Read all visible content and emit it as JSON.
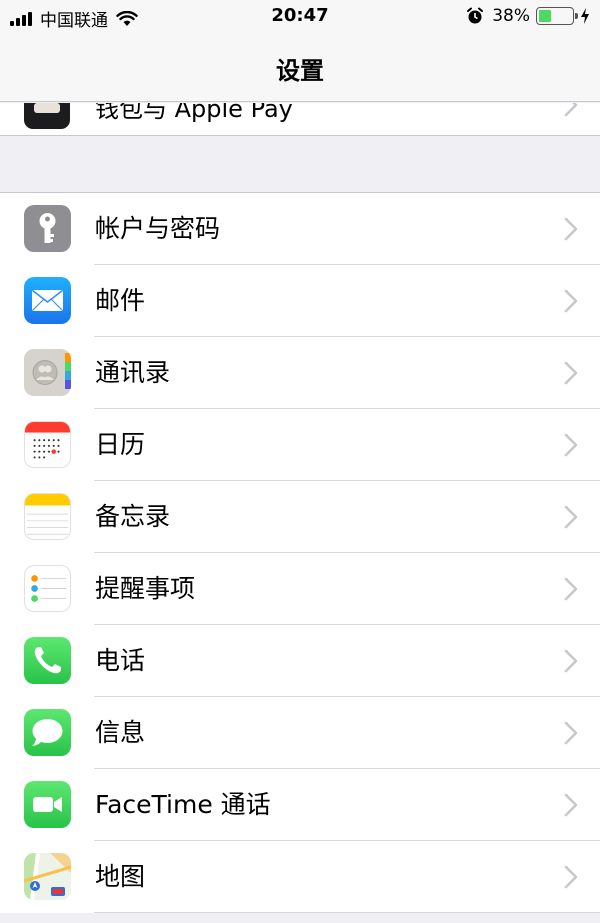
{
  "status_bar": {
    "carrier": "中国联通",
    "time": "20:47",
    "battery_percent": "38%",
    "battery_level": 0.38
  },
  "nav": {
    "title": "设置"
  },
  "partial_item": {
    "label": "钱包与 Apple Pay",
    "icon": "wallet-icon"
  },
  "items": [
    {
      "label": "帐户与密码",
      "icon": "key-icon",
      "color": "#8e8e93"
    },
    {
      "label": "邮件",
      "icon": "mail-icon",
      "color": "#1e88f3"
    },
    {
      "label": "通讯录",
      "icon": "contacts-icon",
      "color": "#c9c6c1"
    },
    {
      "label": "日历",
      "icon": "calendar-icon",
      "color": "#ffffff"
    },
    {
      "label": "备忘录",
      "icon": "notes-icon",
      "color": "#ffcc00"
    },
    {
      "label": "提醒事项",
      "icon": "reminders-icon",
      "color": "#ffffff"
    },
    {
      "label": "电话",
      "icon": "phone-icon",
      "color": "#3fd15a"
    },
    {
      "label": "信息",
      "icon": "messages-icon",
      "color": "#3fd15a"
    },
    {
      "label": "FaceTime 通话",
      "icon": "facetime-icon",
      "color": "#3fd15a"
    },
    {
      "label": "地图",
      "icon": "maps-icon",
      "color": "#e8eef2"
    }
  ]
}
